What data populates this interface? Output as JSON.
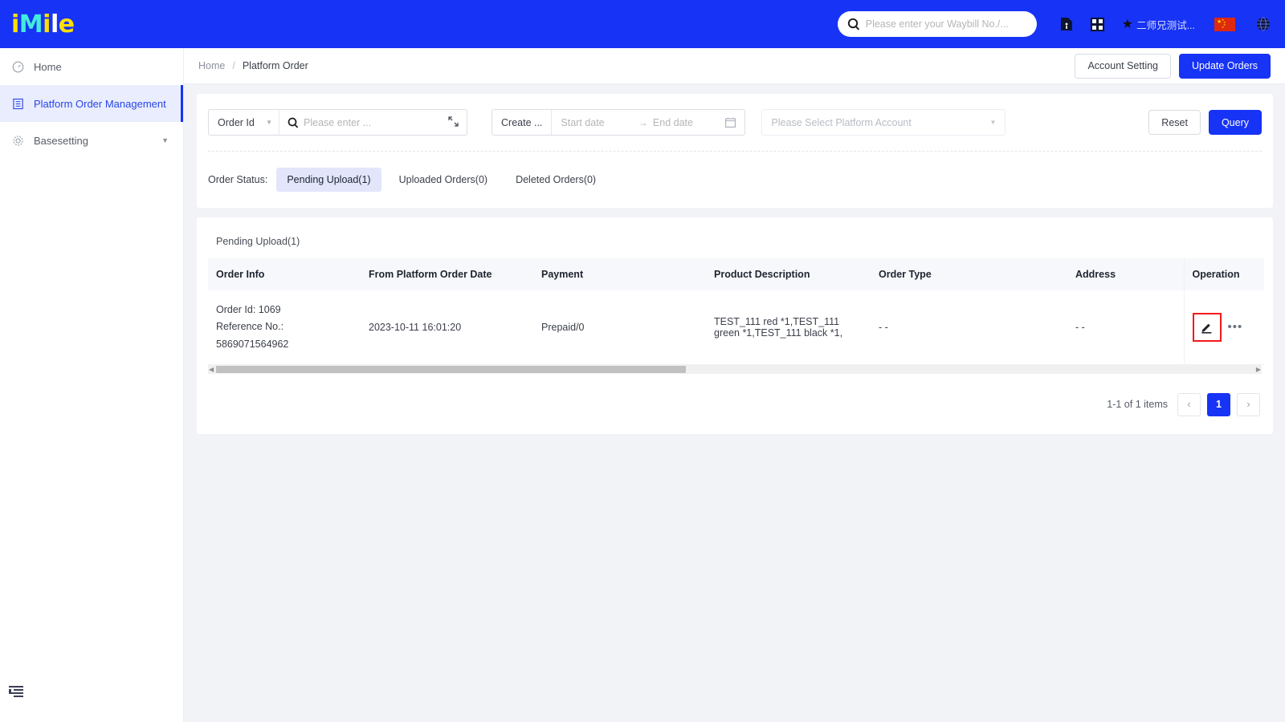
{
  "brand": {
    "logo_parts": [
      "i",
      "M",
      "i",
      "l",
      "e"
    ],
    "accent_blue": "#1733f5",
    "accent_yellow": "#ffe000",
    "accent_cyan": "#42ecdc",
    "highlight_red": "#f51919"
  },
  "header": {
    "search_placeholder": "Please enter your Waybill No./...",
    "search_value": "",
    "search_icon": "search-icon",
    "doc_icon": "document-info-icon",
    "grid_icon": "grid-apps-icon",
    "star_icon": "star-icon",
    "user_name": "二师兄测试...",
    "flag_icon": "china-flag-icon",
    "globe_icon": "globe-language-icon"
  },
  "sidebar": {
    "items": [
      {
        "label": "Home",
        "icon": "dashboard-icon",
        "active": false,
        "has_chevron": false
      },
      {
        "label": "Platform Order Management",
        "icon": "list-document-icon",
        "active": true,
        "has_chevron": false
      },
      {
        "label": "Basesetting",
        "icon": "gear-icon",
        "active": false,
        "has_chevron": true
      }
    ],
    "collapse_icon": "sidebar-collapse-icon"
  },
  "breadcrumb": {
    "items": [
      "Home",
      "Platform Order"
    ],
    "separator": "/"
  },
  "page_actions": {
    "account_setting": "Account Setting",
    "update_orders": "Update Orders"
  },
  "filters": {
    "field_select_value": "Order Id",
    "keyword_placeholder": "Please enter ...",
    "keyword_value": "",
    "keyword_search_icon": "search-icon",
    "expand_icon": "expand-collapse-icon",
    "date_label": "Create ...",
    "start_date_placeholder": "Start date",
    "end_date_placeholder": "End date",
    "date_arrow": "→",
    "calendar_icon": "calendar-icon",
    "platform_account_placeholder": "Please Select Platform Account",
    "reset_label": "Reset",
    "query_label": "Query"
  },
  "order_status": {
    "label": "Order Status:",
    "tabs": [
      {
        "label": "Pending Upload(1)",
        "active": true
      },
      {
        "label": "Uploaded Orders(0)",
        "active": false
      },
      {
        "label": "Deleted Orders(0)",
        "active": false
      }
    ]
  },
  "table": {
    "tab_label": "Pending Upload(1)",
    "columns": [
      "Order Info",
      "From Platform Order Date",
      "Payment",
      "Product Description",
      "Order Type",
      "Address",
      "Operation"
    ],
    "rows": [
      {
        "order_id_line": "Order Id: 1069",
        "reference_line": "Reference No.: 5869071564962",
        "order_date": "2023-10-11 16:01:20",
        "payment": "Prepaid/0",
        "product_description": "TEST_111 red *1,TEST_111 green *1,TEST_111 black *1,",
        "order_type": "- -",
        "address": "- -",
        "edit_icon": "edit-pencil-icon",
        "more_icon": "more-horizontal-icon"
      }
    ],
    "scrollbar": {
      "left_arrow": "◀",
      "right_arrow": "▶"
    }
  },
  "pagination": {
    "count_text": "1-1 of 1 items",
    "prev_label": "‹",
    "next_label": "›",
    "pages": [
      {
        "label": "1",
        "current": true
      }
    ]
  }
}
